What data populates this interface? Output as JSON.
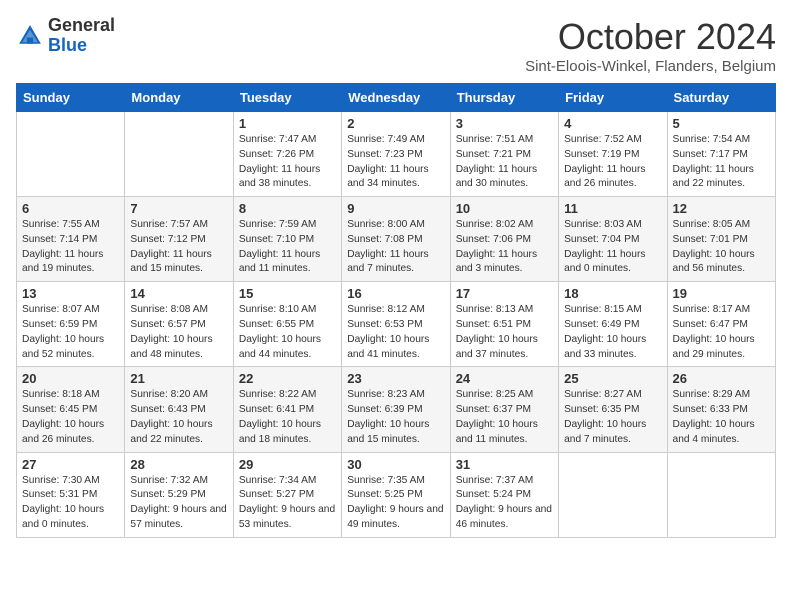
{
  "header": {
    "logo_general": "General",
    "logo_blue": "Blue",
    "month_title": "October 2024",
    "subtitle": "Sint-Eloois-Winkel, Flanders, Belgium"
  },
  "days_of_week": [
    "Sunday",
    "Monday",
    "Tuesday",
    "Wednesday",
    "Thursday",
    "Friday",
    "Saturday"
  ],
  "weeks": [
    [
      {
        "day": "",
        "info": ""
      },
      {
        "day": "",
        "info": ""
      },
      {
        "day": "1",
        "info": "Sunrise: 7:47 AM\nSunset: 7:26 PM\nDaylight: 11 hours and 38 minutes."
      },
      {
        "day": "2",
        "info": "Sunrise: 7:49 AM\nSunset: 7:23 PM\nDaylight: 11 hours and 34 minutes."
      },
      {
        "day": "3",
        "info": "Sunrise: 7:51 AM\nSunset: 7:21 PM\nDaylight: 11 hours and 30 minutes."
      },
      {
        "day": "4",
        "info": "Sunrise: 7:52 AM\nSunset: 7:19 PM\nDaylight: 11 hours and 26 minutes."
      },
      {
        "day": "5",
        "info": "Sunrise: 7:54 AM\nSunset: 7:17 PM\nDaylight: 11 hours and 22 minutes."
      }
    ],
    [
      {
        "day": "6",
        "info": "Sunrise: 7:55 AM\nSunset: 7:14 PM\nDaylight: 11 hours and 19 minutes."
      },
      {
        "day": "7",
        "info": "Sunrise: 7:57 AM\nSunset: 7:12 PM\nDaylight: 11 hours and 15 minutes."
      },
      {
        "day": "8",
        "info": "Sunrise: 7:59 AM\nSunset: 7:10 PM\nDaylight: 11 hours and 11 minutes."
      },
      {
        "day": "9",
        "info": "Sunrise: 8:00 AM\nSunset: 7:08 PM\nDaylight: 11 hours and 7 minutes."
      },
      {
        "day": "10",
        "info": "Sunrise: 8:02 AM\nSunset: 7:06 PM\nDaylight: 11 hours and 3 minutes."
      },
      {
        "day": "11",
        "info": "Sunrise: 8:03 AM\nSunset: 7:04 PM\nDaylight: 11 hours and 0 minutes."
      },
      {
        "day": "12",
        "info": "Sunrise: 8:05 AM\nSunset: 7:01 PM\nDaylight: 10 hours and 56 minutes."
      }
    ],
    [
      {
        "day": "13",
        "info": "Sunrise: 8:07 AM\nSunset: 6:59 PM\nDaylight: 10 hours and 52 minutes."
      },
      {
        "day": "14",
        "info": "Sunrise: 8:08 AM\nSunset: 6:57 PM\nDaylight: 10 hours and 48 minutes."
      },
      {
        "day": "15",
        "info": "Sunrise: 8:10 AM\nSunset: 6:55 PM\nDaylight: 10 hours and 44 minutes."
      },
      {
        "day": "16",
        "info": "Sunrise: 8:12 AM\nSunset: 6:53 PM\nDaylight: 10 hours and 41 minutes."
      },
      {
        "day": "17",
        "info": "Sunrise: 8:13 AM\nSunset: 6:51 PM\nDaylight: 10 hours and 37 minutes."
      },
      {
        "day": "18",
        "info": "Sunrise: 8:15 AM\nSunset: 6:49 PM\nDaylight: 10 hours and 33 minutes."
      },
      {
        "day": "19",
        "info": "Sunrise: 8:17 AM\nSunset: 6:47 PM\nDaylight: 10 hours and 29 minutes."
      }
    ],
    [
      {
        "day": "20",
        "info": "Sunrise: 8:18 AM\nSunset: 6:45 PM\nDaylight: 10 hours and 26 minutes."
      },
      {
        "day": "21",
        "info": "Sunrise: 8:20 AM\nSunset: 6:43 PM\nDaylight: 10 hours and 22 minutes."
      },
      {
        "day": "22",
        "info": "Sunrise: 8:22 AM\nSunset: 6:41 PM\nDaylight: 10 hours and 18 minutes."
      },
      {
        "day": "23",
        "info": "Sunrise: 8:23 AM\nSunset: 6:39 PM\nDaylight: 10 hours and 15 minutes."
      },
      {
        "day": "24",
        "info": "Sunrise: 8:25 AM\nSunset: 6:37 PM\nDaylight: 10 hours and 11 minutes."
      },
      {
        "day": "25",
        "info": "Sunrise: 8:27 AM\nSunset: 6:35 PM\nDaylight: 10 hours and 7 minutes."
      },
      {
        "day": "26",
        "info": "Sunrise: 8:29 AM\nSunset: 6:33 PM\nDaylight: 10 hours and 4 minutes."
      }
    ],
    [
      {
        "day": "27",
        "info": "Sunrise: 7:30 AM\nSunset: 5:31 PM\nDaylight: 10 hours and 0 minutes."
      },
      {
        "day": "28",
        "info": "Sunrise: 7:32 AM\nSunset: 5:29 PM\nDaylight: 9 hours and 57 minutes."
      },
      {
        "day": "29",
        "info": "Sunrise: 7:34 AM\nSunset: 5:27 PM\nDaylight: 9 hours and 53 minutes."
      },
      {
        "day": "30",
        "info": "Sunrise: 7:35 AM\nSunset: 5:25 PM\nDaylight: 9 hours and 49 minutes."
      },
      {
        "day": "31",
        "info": "Sunrise: 7:37 AM\nSunset: 5:24 PM\nDaylight: 9 hours and 46 minutes."
      },
      {
        "day": "",
        "info": ""
      },
      {
        "day": "",
        "info": ""
      }
    ]
  ]
}
